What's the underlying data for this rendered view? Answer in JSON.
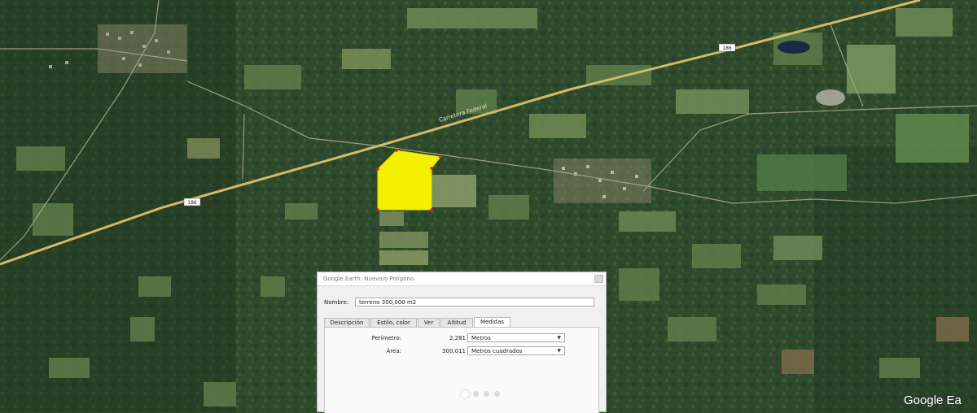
{
  "map": {
    "road_labels": [
      "186",
      "186"
    ],
    "road_name": "Carretera Federal",
    "watermark": "Google Ea",
    "colors": {
      "polygon_fill": "#f5f000",
      "polygon_vertex": "#e02020",
      "road": "#d2b96a"
    }
  },
  "dialog": {
    "title": "Google Earth: Nuevo/o Polígono",
    "name_label": "Nombre:",
    "name_value": "terreno 300,000 m2",
    "tabs": [
      {
        "label": "Descripción"
      },
      {
        "label": "Estilo, color"
      },
      {
        "label": "Ver"
      },
      {
        "label": "Altitud"
      },
      {
        "label": "Medidas",
        "active": true
      }
    ],
    "measurements": [
      {
        "label": "Perímetro:",
        "value": "2,281",
        "unit": "Metros"
      },
      {
        "label": "Área:",
        "value": "300,011",
        "unit": "Metros cuadrados"
      }
    ],
    "pager_total": 4,
    "pager_current": 1
  }
}
